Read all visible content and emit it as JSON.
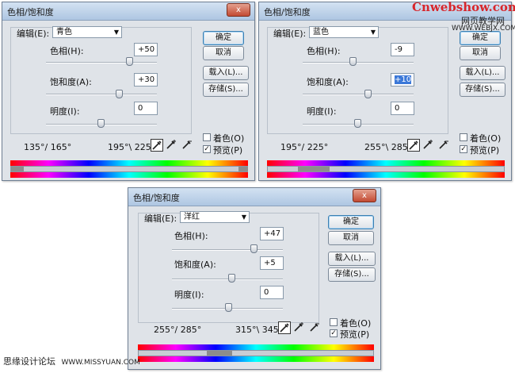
{
  "dialogs": [
    {
      "title": "色相/饱和度",
      "edit_label": "编辑(E):",
      "edit_value": "青色",
      "hue_label": "色相(H):",
      "hue_value": "+50",
      "saturation_label": "饱和度(A):",
      "saturation_value": "+30",
      "lightness_label": "明度(I):",
      "lightness_value": "0",
      "range_left": "135°/ 165°",
      "range_right": "195°\\ 225°",
      "ok_label": "确定",
      "cancel_label": "取消",
      "load_label": "载入(L)...",
      "save_label": "存储(S)...",
      "colorize_label": "着色(O)",
      "preview_label": "预览(P)",
      "colorize_checked": false,
      "preview_checked": true
    },
    {
      "title": "色相/饱和度",
      "edit_label": "编辑(E):",
      "edit_value": "蓝色",
      "hue_label": "色相(H):",
      "hue_value": "-9",
      "saturation_label": "饱和度(A):",
      "saturation_value": "+10",
      "lightness_label": "明度(I):",
      "lightness_value": "0",
      "range_left": "195°/ 225°",
      "range_right": "255°\\ 285°",
      "ok_label": "确定",
      "cancel_label": "取消",
      "load_label": "载入(L)...",
      "save_label": "存储(S)...",
      "colorize_label": "着色(O)",
      "preview_label": "预览(P)",
      "colorize_checked": false,
      "preview_checked": true
    },
    {
      "title": "色相/饱和度",
      "edit_label": "编辑(E):",
      "edit_value": "洋红",
      "hue_label": "色相(H):",
      "hue_value": "+47",
      "saturation_label": "饱和度(A):",
      "saturation_value": "+5",
      "lightness_label": "明度(I):",
      "lightness_value": "0",
      "range_left": "255°/ 285°",
      "range_right": "315°\\ 345°",
      "ok_label": "确定",
      "cancel_label": "取消",
      "load_label": "载入(L)...",
      "save_label": "存储(S)...",
      "colorize_label": "着色(O)",
      "preview_label": "预览(P)",
      "colorize_checked": false,
      "preview_checked": true
    }
  ],
  "close_glyph": "x",
  "watermark_top": "Cnwebshow.com",
  "watermark_top_sub": "网页教学网",
  "watermark_top_url": "WWW.WEBJX.COM",
  "watermark_bottom": "思缘设计论坛",
  "watermark_bottom_url": "WWW.MISSYUAN.COM",
  "colors": {
    "accent": "#3b78d8",
    "watermark_red": "#d8262b"
  }
}
